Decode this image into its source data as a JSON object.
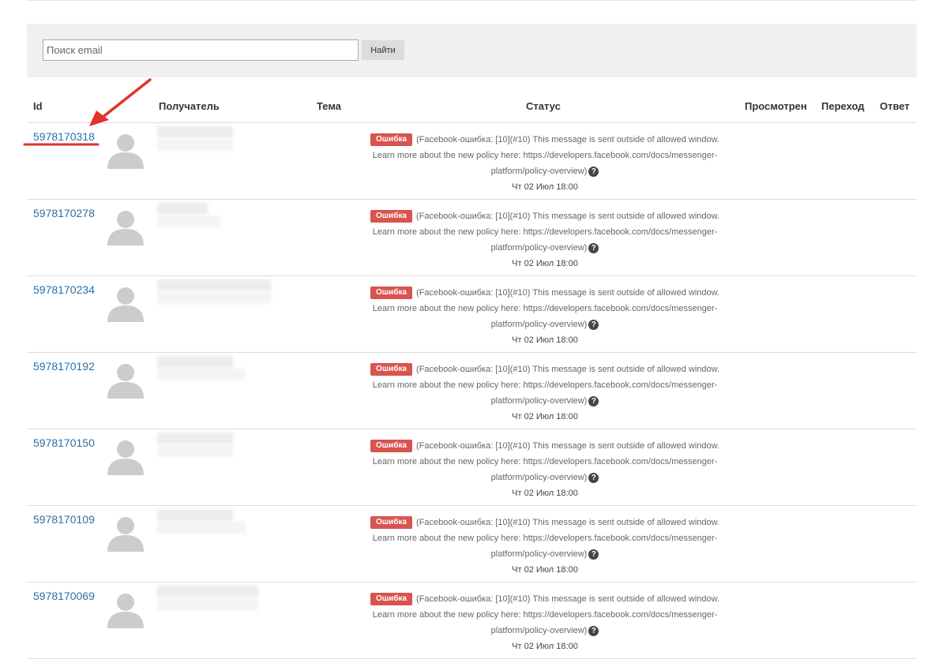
{
  "search": {
    "placeholder": "Поиск email",
    "value": "",
    "button_label": "Найти"
  },
  "table": {
    "headers": {
      "id": "Id",
      "recipient": "Получатель",
      "subject": "Тема",
      "status": "Статус",
      "viewed": "Просмотрен",
      "click": "Переход",
      "reply": "Ответ"
    },
    "rows": [
      {
        "id": "5978170318",
        "status_badge": "Ошибка",
        "status_line1": "(Facebook-ошибка: [10](#10) This message is sent outside of allowed window.",
        "status_line2": "Learn more about the new policy here: https://developers.facebook.com/docs/messenger-",
        "status_line3": "platform/policy-overview)",
        "datetime": "Чт 02 Июл 18:00"
      },
      {
        "id": "5978170278",
        "status_badge": "Ошибка",
        "status_line1": "(Facebook-ошибка: [10](#10) This message is sent outside of allowed window.",
        "status_line2": "Learn more about the new policy here: https://developers.facebook.com/docs/messenger-",
        "status_line3": "platform/policy-overview)",
        "datetime": "Чт 02 Июл 18:00"
      },
      {
        "id": "5978170234",
        "status_badge": "Ошибка",
        "status_line1": "(Facebook-ошибка: [10](#10) This message is sent outside of allowed window.",
        "status_line2": "Learn more about the new policy here: https://developers.facebook.com/docs/messenger-",
        "status_line3": "platform/policy-overview)",
        "datetime": "Чт 02 Июл 18:00"
      },
      {
        "id": "5978170192",
        "status_badge": "Ошибка",
        "status_line1": "(Facebook-ошибка: [10](#10) This message is sent outside of allowed window.",
        "status_line2": "Learn more about the new policy here: https://developers.facebook.com/docs/messenger-",
        "status_line3": "platform/policy-overview)",
        "datetime": "Чт 02 Июл 18:00"
      },
      {
        "id": "5978170150",
        "status_badge": "Ошибка",
        "status_line1": "(Facebook-ошибка: [10](#10) This message is sent outside of allowed window.",
        "status_line2": "Learn more about the new policy here: https://developers.facebook.com/docs/messenger-",
        "status_line3": "platform/policy-overview)",
        "datetime": "Чт 02 Июл 18:00"
      },
      {
        "id": "5978170109",
        "status_badge": "Ошибка",
        "status_line1": "(Facebook-ошибка: [10](#10) This message is sent outside of allowed window.",
        "status_line2": "Learn more about the new policy here: https://developers.facebook.com/docs/messenger-",
        "status_line3": "platform/policy-overview)",
        "datetime": "Чт 02 Июл 18:00"
      },
      {
        "id": "5978170069",
        "status_badge": "Ошибка",
        "status_line1": "(Facebook-ошибка: [10](#10) This message is sent outside of allowed window.",
        "status_line2": "Learn more about the new policy here: https://developers.facebook.com/docs/messenger-",
        "status_line3": "platform/policy-overview)",
        "datetime": "Чт 02 Июл 18:00"
      }
    ]
  },
  "icons": {
    "avatar": "avatar-placeholder-icon",
    "help": "question-circle-icon"
  },
  "colors": {
    "link": "#2a6fa8",
    "error_badge": "#d9534f",
    "annotation": "#e0332a",
    "panel": "#f0f0f0"
  }
}
